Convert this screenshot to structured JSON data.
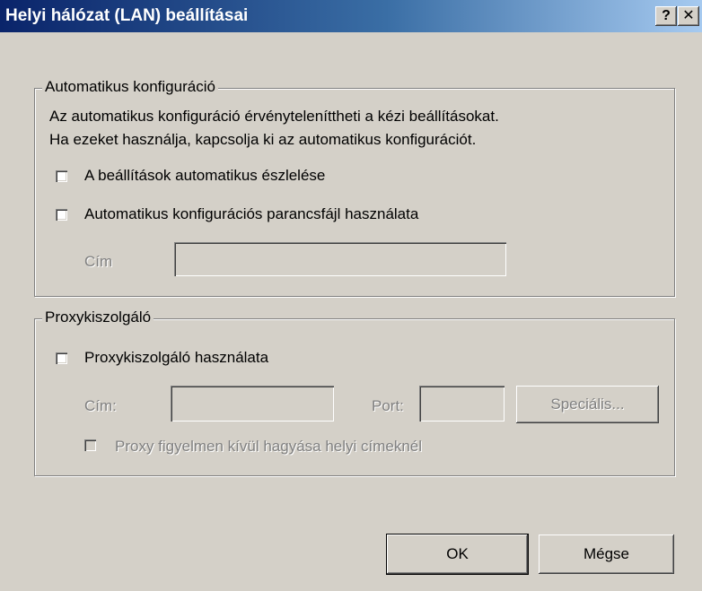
{
  "window": {
    "title": "Helyi hálózat (LAN) beállításai",
    "help_label": "?",
    "close_label": "✕"
  },
  "auto_config": {
    "legend": "Automatikus konfiguráció",
    "description_line1": "Az automatikus konfiguráció érvényteleníttheti a kézi beállításokat.",
    "description_line2": "Ha ezeket használja, kapcsolja ki az automatikus konfigurációt.",
    "detect_label": "A beállítások automatikus észlelése",
    "detect_checked": false,
    "script_label": "Automatikus konfigurációs parancsfájl használata",
    "script_checked": false,
    "address_label": "Cím",
    "address_value": ""
  },
  "proxy": {
    "legend": "Proxykiszolgáló",
    "use_proxy_label": "Proxykiszolgáló használata",
    "use_proxy_checked": false,
    "address_label": "Cím:",
    "address_value": "",
    "port_label": "Port:",
    "port_value": "",
    "advanced_label": "Speciális...",
    "bypass_label": "Proxy figyelmen kívül hagyása helyi címeknél",
    "bypass_checked": false
  },
  "buttons": {
    "ok": "OK",
    "cancel": "Mégse"
  }
}
